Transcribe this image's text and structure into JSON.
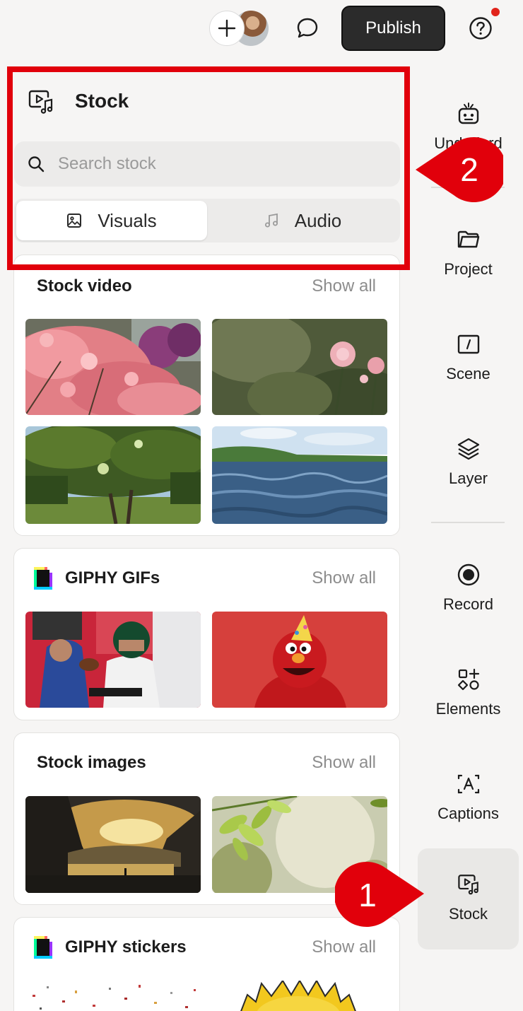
{
  "colors": {
    "accent_red": "#e1000b",
    "publish_bg": "#2b2b2b",
    "notification_dot": "#e1241b"
  },
  "topbar": {
    "publish_label": "Publish"
  },
  "panel": {
    "title": "Stock",
    "search_placeholder": "Search stock",
    "tabs": [
      {
        "label": "Visuals",
        "icon": "image-icon",
        "active": true
      },
      {
        "label": "Audio",
        "icon": "music-note-icon",
        "active": false
      }
    ]
  },
  "sections": [
    {
      "title": "Stock video",
      "show_all": "Show all"
    },
    {
      "title": "GIPHY GIFs",
      "show_all": "Show all"
    },
    {
      "title": "Stock images",
      "show_all": "Show all"
    },
    {
      "title": "GIPHY stickers",
      "show_all": "Show all"
    }
  ],
  "sidebar": {
    "items": [
      {
        "label": "Underlord",
        "icon": "robot-icon"
      },
      {
        "label": "Project",
        "icon": "folder-icon"
      },
      {
        "label": "Scene",
        "icon": "scene-icon"
      },
      {
        "label": "Layer",
        "icon": "layers-icon"
      },
      {
        "label": "Record",
        "icon": "record-icon"
      },
      {
        "label": "Elements",
        "icon": "elements-icon"
      },
      {
        "label": "Captions",
        "icon": "captions-icon"
      },
      {
        "label": "Stock",
        "icon": "stock-media-icon",
        "active": true
      }
    ]
  },
  "callouts": {
    "first": "1",
    "second": "2"
  }
}
